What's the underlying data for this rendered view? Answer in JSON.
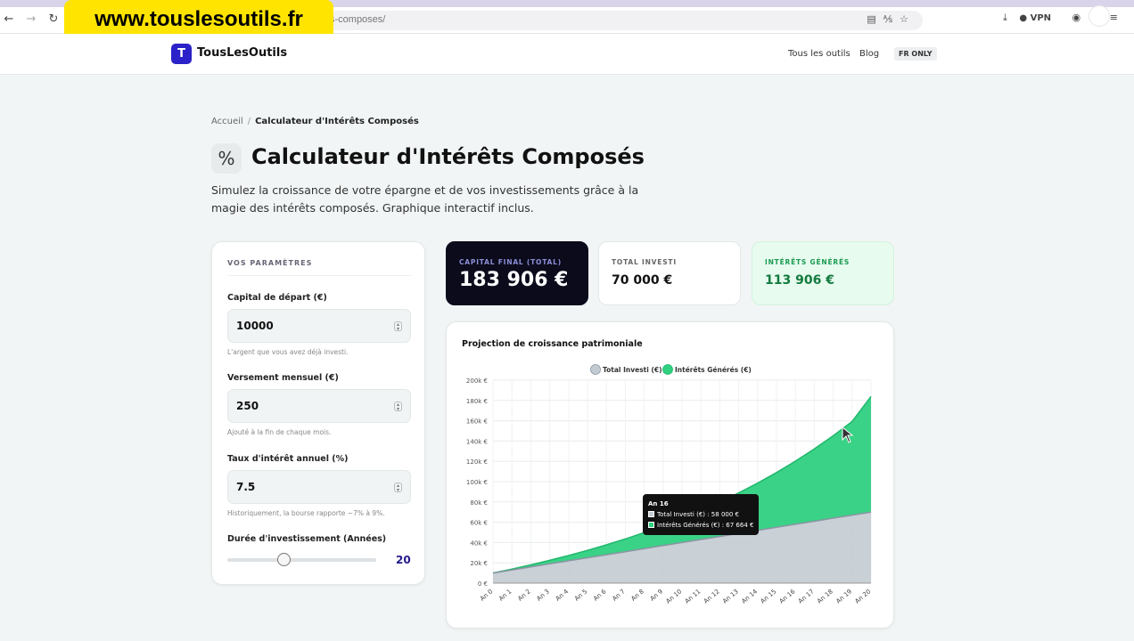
{
  "browser": {
    "url_fragment": "s-composes/",
    "vpn_label": "VPN",
    "watermark": "www.touslesoutils.fr"
  },
  "site": {
    "logo_letter": "T",
    "logo_text": "TousLesOutils",
    "nav": [
      "Tous les outils",
      "Blog"
    ],
    "lang_badge": "FR ONLY"
  },
  "breadcrumb": {
    "home": "Accueil",
    "separator": "/",
    "current": "Calculateur d'Intérêts Composés"
  },
  "page": {
    "icon": "%",
    "title": "Calculateur d'Intérêts Composés",
    "description": "Simulez la croissance de votre épargne et de vos investissements grâce à la magie des intérêts composés. Graphique interactif inclus."
  },
  "params": {
    "section_label": "VOS PARAMÈTRES",
    "fields": [
      {
        "label": "Capital de départ (€)",
        "value": "10000",
        "hint": "L'argent que vous avez déjà investi."
      },
      {
        "label": "Versement mensuel (€)",
        "value": "250",
        "hint": "Ajouté à la fin de chaque mois."
      },
      {
        "label": "Taux d'intérêt annuel (%)",
        "value": "7.5",
        "hint": "Historiquement, la bourse rapporte ~7% à 9%."
      }
    ],
    "duration": {
      "label": "Durée d'investissement (Années)",
      "value": "20",
      "fraction": 0.375
    }
  },
  "stats": {
    "final": {
      "label": "CAPITAL FINAL (TOTAL)",
      "value": "183 906 €"
    },
    "invested": {
      "label": "TOTAL INVESTI",
      "value": "70 000 €"
    },
    "interest": {
      "label": "INTÉRÊTS GÉNÉRÉS",
      "value": "113 906 €"
    }
  },
  "colors": {
    "accent": "#2b22c9",
    "invested": "#c3cbd2",
    "invested_line": "#8a95a3",
    "interest": "#2fd080",
    "interest_line": "#1fb86c"
  },
  "chart_data": {
    "type": "area",
    "title": "Projection de croissance patrimoniale",
    "stacked": true,
    "x": [
      "An 0",
      "An 1",
      "An 2",
      "An 3",
      "An 4",
      "An 5",
      "An 6",
      "An 7",
      "An 8",
      "An 9",
      "An 10",
      "An 11",
      "An 12",
      "An 13",
      "An 14",
      "An 15",
      "An 16",
      "An 17",
      "An 18",
      "An 19",
      "An 20"
    ],
    "series": [
      {
        "name": "Total Investi (€)",
        "values": [
          10000,
          13000,
          16000,
          19000,
          22000,
          25000,
          28000,
          31000,
          34000,
          37000,
          40000,
          43000,
          46000,
          49000,
          52000,
          55000,
          58000,
          61000,
          64000,
          67000,
          70000
        ]
      },
      {
        "name": "Intérêts Générés (€)",
        "values": [
          0,
          862,
          1995,
          3419,
          5159,
          7237,
          9682,
          12523,
          15792,
          19522,
          23751,
          28521,
          33874,
          39860,
          46530,
          53938,
          62143,
          71206,
          81195,
          92181,
          113906
        ]
      }
    ],
    "y_ticks": [
      "0 €",
      "20k €",
      "40k €",
      "60k €",
      "80k €",
      "100k €",
      "120k €",
      "140k €",
      "160k €",
      "180k €",
      "200k €"
    ],
    "ylim": [
      0,
      200000
    ],
    "grid": true,
    "legend": "top",
    "tooltip": {
      "title": "An 16",
      "lines": [
        "Total Investi (€) : 58 000 €",
        "Intérêts Générés (€) : 67 664 €"
      ]
    }
  }
}
